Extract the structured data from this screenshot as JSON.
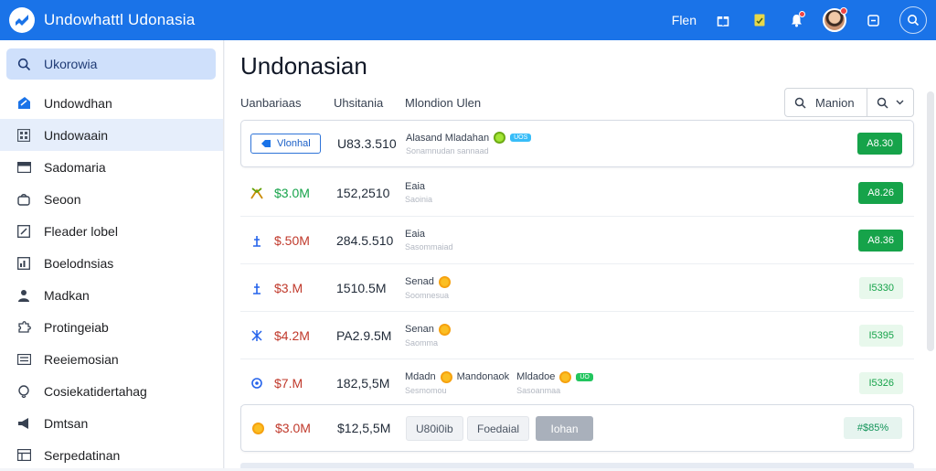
{
  "app": {
    "title": "Undowhattl Udonasia"
  },
  "topbar": {
    "link_label": "Flen"
  },
  "sidebar": {
    "search_label": "Ukorowia",
    "items": [
      {
        "label": "Undowdhan",
        "icon": "home-icon"
      },
      {
        "label": "Undowaain",
        "icon": "grid-icon"
      },
      {
        "label": "Sadomaria",
        "icon": "inbox-icon"
      },
      {
        "label": "Seoon",
        "icon": "bag-icon"
      },
      {
        "label": "Fleader lobel",
        "icon": "edit-icon"
      },
      {
        "label": "Boelodnsias",
        "icon": "chart-icon"
      },
      {
        "label": "Madkan",
        "icon": "user-icon"
      },
      {
        "label": "Protingeiab",
        "icon": "puzzle-icon"
      },
      {
        "label": "Reeiemosian",
        "icon": "list-icon"
      },
      {
        "label": "Cosiekatidertahag",
        "icon": "tag-icon"
      },
      {
        "label": "Dmtsan",
        "icon": "megaphone-icon"
      },
      {
        "label": "Serpedatinan",
        "icon": "table-icon"
      }
    ]
  },
  "main": {
    "title": "Undonasian",
    "columns": [
      "Uanbariaas",
      "Uhsitania",
      "Mlondion Ulen"
    ],
    "search": {
      "label": "Manion"
    },
    "rows": [
      {
        "chip": "Vlonhal",
        "number": "U83.3.510",
        "title": "Alasand Mladahan",
        "sub": "Sonamnudan sannaad",
        "badge": "UOS",
        "status": "A8.30"
      },
      {
        "value": "$3.0M",
        "number": "152,2510",
        "title": "Eaia",
        "sub": "Saoinia",
        "status": "A8.26"
      },
      {
        "value": "$.50M",
        "number": "284.5.510",
        "title": "Eaia",
        "sub": "Sasommaiad",
        "status": "A8.36"
      },
      {
        "value": "$3.M",
        "number": "1510.5M",
        "title": "Senad",
        "sub": "Soomnesua",
        "status": "I5330"
      },
      {
        "value": "$4.2M",
        "number": "PA2.9.5M",
        "title": "Senan",
        "sub": "Saomma",
        "status": "I5395"
      },
      {
        "value": "$7.M",
        "number": "182,5,5M",
        "title": "Mdadn",
        "sub": "Sesmomou",
        "title2": "Mandonaok",
        "title3": "Mldadoe",
        "sub3": "Sasoanmaa",
        "badge": "UO",
        "status": "I5326"
      },
      {
        "value": "$3.0M",
        "number": "$12,5,5M",
        "btn1": "U80i0ib",
        "btn2": "Foedaial",
        "btn3": "Iohan",
        "status": "#$85%"
      }
    ]
  },
  "colors": {
    "accent": "#1a73e8",
    "positive": "#16a34a",
    "negative": "#c0392b"
  }
}
